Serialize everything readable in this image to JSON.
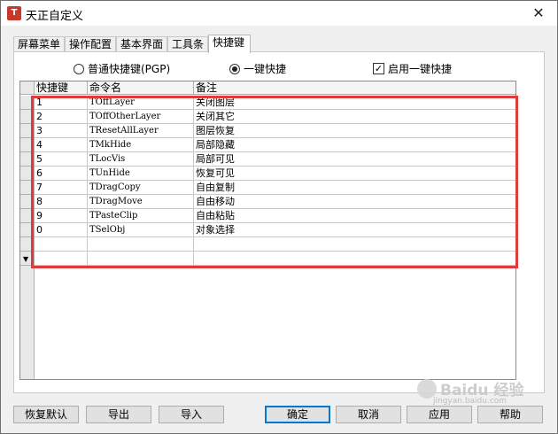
{
  "window": {
    "title": "天正自定义",
    "close_glyph": "✕"
  },
  "tabs": [
    {
      "label": "屏幕菜单",
      "active": false
    },
    {
      "label": "操作配置",
      "active": false
    },
    {
      "label": "基本界面",
      "active": false
    },
    {
      "label": "工具条",
      "active": false
    },
    {
      "label": "快捷键",
      "active": true
    }
  ],
  "options": {
    "radio_normal": "普通快捷键(PGP)",
    "radio_onekey": "一键快捷",
    "selected": "一键快捷",
    "checkbox_label": "启用一键快捷",
    "checkbox_checked": true
  },
  "grid": {
    "headers": [
      "快捷键",
      "命令名",
      "备注"
    ],
    "rows": [
      {
        "key": "1",
        "command": "TOffLayer",
        "note": "关闭图层"
      },
      {
        "key": "2",
        "command": "TOffOtherLayer",
        "note": "关闭其它"
      },
      {
        "key": "3",
        "command": "TResetAllLayer",
        "note": "图层恢复"
      },
      {
        "key": "4",
        "command": "TMkHide",
        "note": "局部隐藏"
      },
      {
        "key": "5",
        "command": "TLocVis",
        "note": "局部可见"
      },
      {
        "key": "6",
        "command": "TUnHide",
        "note": "恢复可见"
      },
      {
        "key": "7",
        "command": "TDragCopy",
        "note": "自由复制"
      },
      {
        "key": "8",
        "command": "TDragMove",
        "note": "自由移动"
      },
      {
        "key": "9",
        "command": "TPasteClip",
        "note": "自由粘贴"
      },
      {
        "key": "0",
        "command": "TSelObj",
        "note": "对象选择"
      }
    ]
  },
  "buttons": {
    "restore_default": "恢复默认",
    "export": "导出",
    "import": "导入",
    "ok": "确定",
    "cancel": "取消",
    "apply": "应用",
    "help": "帮助"
  },
  "watermark": {
    "text": "Baidu 经验",
    "sub": "jingyan.baidu.com"
  },
  "colors": {
    "highlight": "#e03b3b",
    "default_button_border": "#0078d7"
  }
}
